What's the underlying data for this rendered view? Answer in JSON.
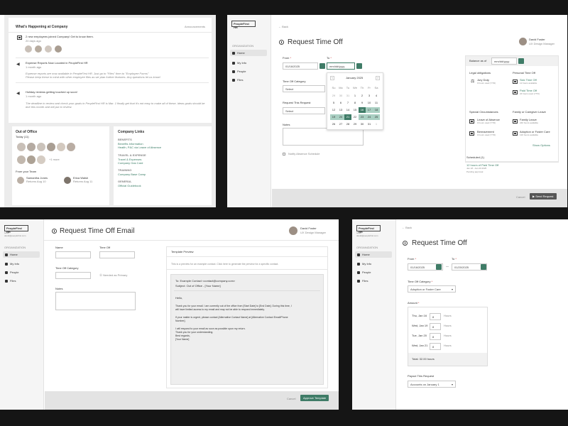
{
  "p1": {
    "whats_happening": "What's Happening at Company",
    "announcements": "Announcements",
    "item1": {
      "title": "2 new employees joined Company! Get to know them.",
      "time": "20 days ago"
    },
    "item2": {
      "title": "Expense Reports Now Located in PeopleFirst HR",
      "time": "1 month ago",
      "body1": "Expense reports are now available in PeopleFirst HR. Just go to \"Files\" then to \"Employee Forms\"",
      "body2": "Please keep these in mind with other employee files as we plan further features. Any questions let us know!"
    },
    "item3": {
      "title": "Holiday reviews getting touched up soon!",
      "time": "1 month ago",
      "body1": "The deadline to review and check your goals in PeopleFirst HR is Mar. 1 finally get that it's not easy to make all of these, ideas goals should be",
      "body2": "due this month and will put to review."
    },
    "out_of_office": "Out of Office",
    "today": "Today (11)",
    "more": "+1 more",
    "from_team": "From your Team",
    "team": [
      {
        "name": "Samantha Jones",
        "ret": "Returns Aug 10"
      },
      {
        "name": "Erica Walsh",
        "ret": "Returns Aug 11"
      }
    ],
    "company_links": "Company Links",
    "links": [
      {
        "h": "BENEFITS",
        "a": "Benefits Information",
        "b": "Health, P&C via Leave of Absence"
      },
      {
        "h": "TRAVEL & EXPENSE",
        "a": "Travel & Expenses",
        "b": "Company Gas Card"
      },
      {
        "h": "TRAINING",
        "a": "Company Base Camp",
        "b": ""
      },
      {
        "h": "GENERAL",
        "a": "Official Guidebook",
        "b": ""
      }
    ]
  },
  "p2": {
    "logo": "PeopleFirst HR",
    "org": "ORGANIZATION",
    "nav": [
      "Home",
      "My Info",
      "People",
      "Files"
    ],
    "back": "Back",
    "title": "Request Time Off",
    "user": {
      "name": "David Foster",
      "role": "UX Design Manager"
    },
    "from_label": "From",
    "to_label": "To",
    "from_value": "01/16/2025",
    "to_placeholder": "mm/dd/yyyy",
    "category_label": "Time Off Category",
    "category_value": "Select",
    "hours_label": "Request This Request",
    "hours_value": "Select",
    "notes_label": "Notes",
    "notify": "Notify Absence Schedule",
    "cal": {
      "month": "January 2025",
      "days": [
        "Su",
        "Mo",
        "Tu",
        "We",
        "Th",
        "Fr",
        "Sa"
      ],
      "rows": [
        [
          "29",
          "30",
          "31",
          "1",
          "2",
          "3",
          "4"
        ],
        [
          "5",
          "6",
          "7",
          "8",
          "9",
          "10",
          "11"
        ],
        [
          "12",
          "13",
          "14",
          "15",
          "16",
          "17",
          "18"
        ],
        [
          "19",
          "20",
          "21",
          "22",
          "23",
          "24",
          "25"
        ],
        [
          "26",
          "27",
          "28",
          "29",
          "30",
          "31",
          "1"
        ]
      ]
    },
    "balance_label": "Balance as of",
    "balance_value": "mm/dd/yyyy",
    "legal": "Legal obligations",
    "personal": "Personal Time Off",
    "jury": {
      "name": "Jury Duty",
      "sub": "0 hours used (YTD)"
    },
    "sick": {
      "name": "Sick Time Off",
      "sub": "12 hours available"
    },
    "pto": {
      "name": "Paid Time Off",
      "sub": "24 hours used (YTD)"
    },
    "special": "Special Circumstances",
    "family": "Family or Caregiver Leave",
    "loa": {
      "name": "Leave of Absence",
      "sub": "0 hours used (YTD)"
    },
    "bereavement": {
      "name": "Bereavement",
      "sub": "0 hours used (YTD)"
    },
    "fam_leave": {
      "name": "Family Leave",
      "sub": "240 hours available"
    },
    "adoption": {
      "name": "Adoption or Foster Care",
      "sub": "120 hours available"
    },
    "show_options": "Show Options",
    "scheduled": "Scheduled (1)",
    "sched_item": "12 hours of Paid Time Off",
    "sched_date": "Jan 18 - Jan 20 2025",
    "sched_status": "Pending approval",
    "cancel": "Cancel",
    "send": "Send Request"
  },
  "p3": {
    "logo": "PeopleFirst HR",
    "email_sub": "Hello",
    "email_sub2": "david@peoplefirst.com",
    "org": "ORGANIZATION",
    "nav": [
      "Home",
      "My Info",
      "People",
      "Files"
    ],
    "title": "Request Time Off Email",
    "user": {
      "name": "David Foster",
      "role": "UX Design Manager"
    },
    "name_label": "Name",
    "time_off_label": "Time Off",
    "category_label": "Time Off Category",
    "email_hint": "Needed as Primary",
    "notes_label": "Notes",
    "preview_title": "Template Preview",
    "preview_hint": "This is a preview for an example contact. Click here to generate the preview for a specific contact.",
    "to_line": "To: Example Contact <contact@company.com>",
    "subject": "Subject: Out of Office - [Your Name]",
    "hello": "Hello,",
    "body1": "Thank you for your email. I am currently out of the office from [Start Date] to [End Date]. During this time, I",
    "body2": "will have limited access to my email and may not be able to respond immediately.",
    "body3": "If your matter is urgent, please contact [Alternative Contact Name] at [Alternative Contact Email/Phone",
    "body4": "Number].",
    "body5": "I will respond to your email as soon as possible upon my return.",
    "body6": "Thank you for your understanding.",
    "body7": "Best regards,",
    "body8": "[Your Name]",
    "cancel": "Cancel",
    "save": "Approve Template"
  },
  "p4": {
    "logo": "PeopleFirst HR",
    "email_sub": "Hello",
    "email_sub2": "david@peoplefirst.com",
    "org": "ORGANIZATION",
    "nav": [
      "Home",
      "My Info",
      "People",
      "Files"
    ],
    "back": "Back",
    "title": "Request Time Off",
    "from_label": "From",
    "to_label": "To",
    "from_value": "01/16/2025",
    "to_value": "01/20/2025",
    "category_label": "Time Off Category",
    "category_value": "Adoption or Foster Care",
    "amount_label": "Amount",
    "amounts": [
      {
        "day": "Thu, Jan 16",
        "val": "8",
        "unit": "Hours"
      },
      {
        "day": "Wed, Jan 19",
        "val": "8",
        "unit": "Hours"
      },
      {
        "day": "Tue, Jan 20",
        "val": "8",
        "unit": "Hours"
      },
      {
        "day": "Wed, Jan 21",
        "val": "8",
        "unit": "Hours"
      }
    ],
    "total": "Total: 32.00 hours",
    "request_label": "Payout This Request",
    "request_value": "Accounts on January 1"
  }
}
